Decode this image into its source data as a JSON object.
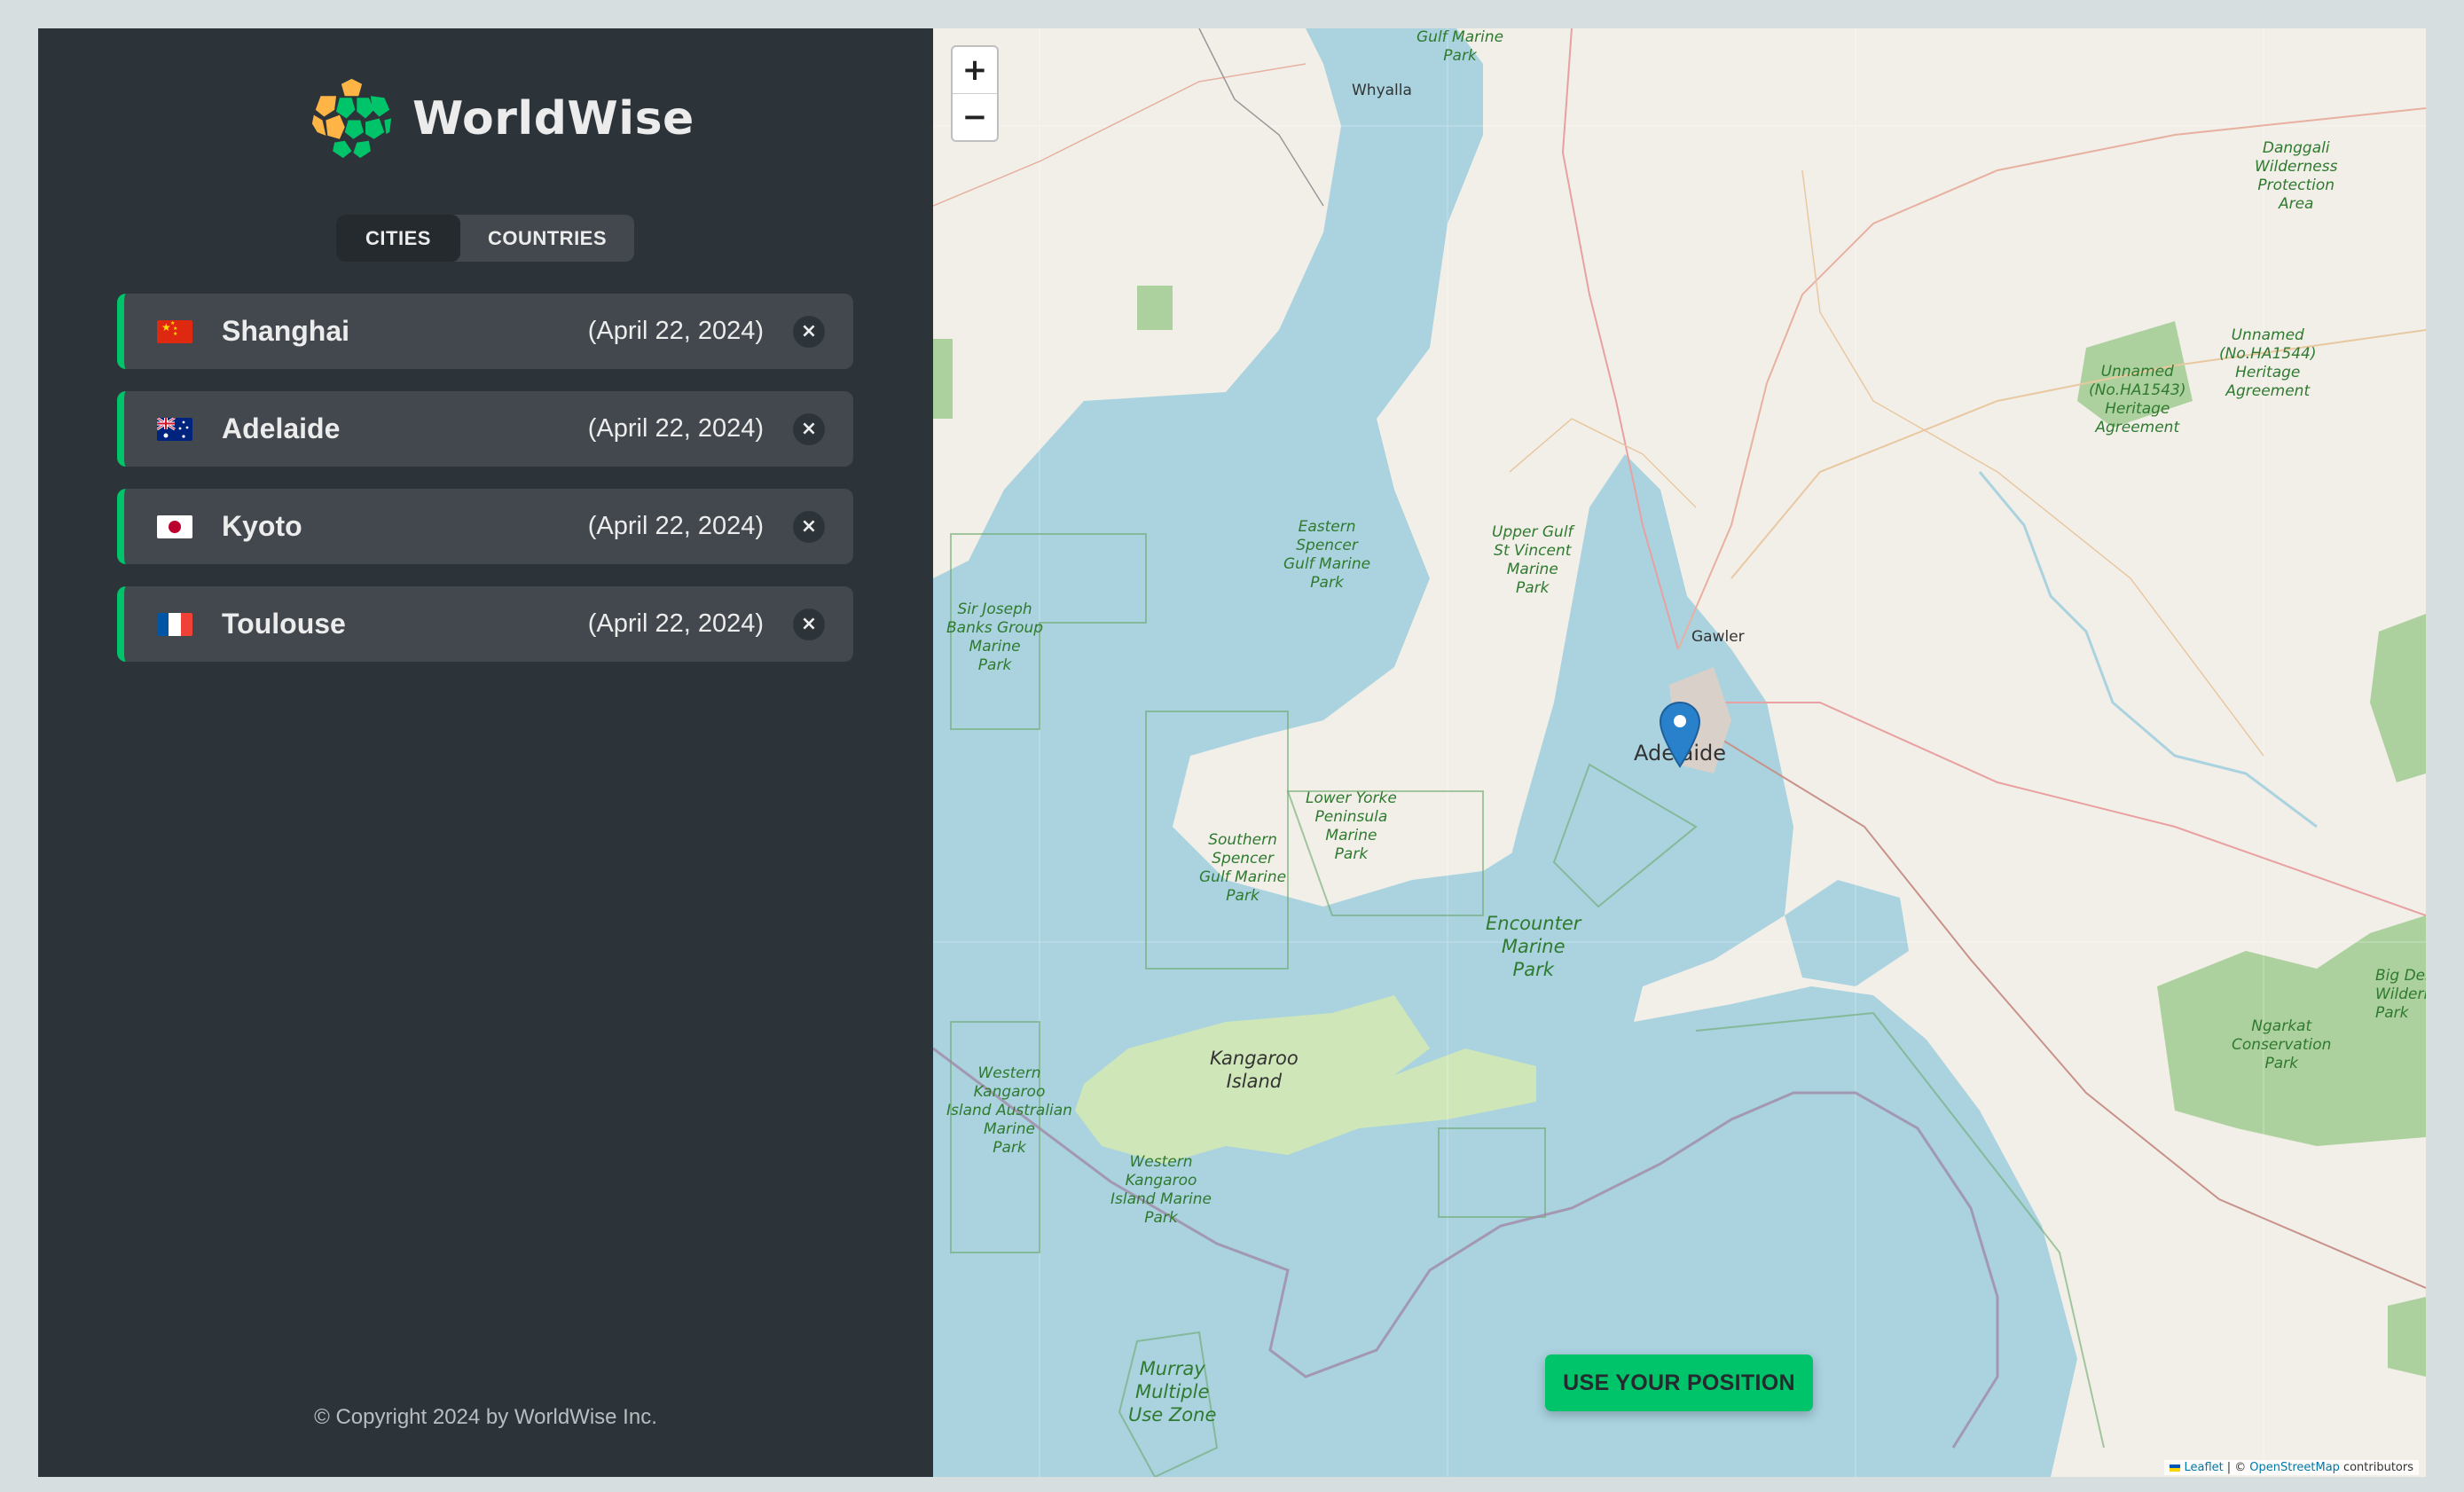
{
  "app": {
    "name": "WorldWise"
  },
  "tabs": {
    "cities": "CITIES",
    "countries": "COUNTRIES",
    "active": "cities"
  },
  "cities": [
    {
      "flag": "china-flag",
      "name": "Shanghai",
      "date": "(April 22, 2024)",
      "delete": "×"
    },
    {
      "flag": "australia-flag",
      "name": "Adelaide",
      "date": "(April 22, 2024)",
      "delete": "×"
    },
    {
      "flag": "japan-flag",
      "name": "Kyoto",
      "date": "(April 22, 2024)",
      "delete": "×"
    },
    {
      "flag": "france-flag",
      "name": "Toulouse",
      "date": "(April 22, 2024)",
      "delete": "×"
    }
  ],
  "footer": {
    "copyright": "© Copyright 2024 by WorldWise Inc."
  },
  "map": {
    "zoom_in": "+",
    "zoom_out": "−",
    "use_position": "USE YOUR POSITION",
    "attribution": {
      "leaflet": "Leaflet",
      "separator": "| ©",
      "osm": "OpenStreetMap",
      "contributors": "contributors"
    },
    "labels": {
      "gulf_marine_park": "Gulf Marine\nPark",
      "whyalla": "Whyalla",
      "dangali": "Danggali\nWilderness\nProtection\nArea",
      "unnamed_1543": "Unnamed\n(No.HA1543)\nHeritage\nAgreement",
      "unnamed_1544": "Unnamed\n(No.HA1544)\nHeritage\nAgreement",
      "eastern_spencer": "Eastern\nSpencer\nGulf Marine\nPark",
      "upper_gulf": "Upper Gulf\nSt Vincent\nMarine\nPark",
      "sir_joseph": "Sir Joseph\nBanks Group\nMarine\nPark",
      "gawler": "Gawler",
      "adelaide": "Adelaide",
      "southern_spencer": "Southern\nSpencer\nGulf Marine\nPark",
      "lower_yorke": "Lower Yorke\nPeninsula\nMarine\nPark",
      "encounter": "Encounter\nMarine\nPark",
      "kangaroo_island": "Kangaroo\nIsland",
      "western_kangaroo": "Western\nKangaroo\nIsland Australian\nMarine\nPark",
      "western_kangaroo_2": "Western\nKangaroo\nIsland Marine\nPark",
      "ngarkat": "Ngarkat\nConservation\nPark",
      "big_desert": "Big Des\nWildern\nPark",
      "murray": "Murray\nMultiple\nUse Zone"
    }
  },
  "colors": {
    "brand": "#00c46a",
    "sidebar": "#2d3439",
    "item": "#42484d",
    "water": "#aad3df",
    "land": "#f2efe9"
  }
}
